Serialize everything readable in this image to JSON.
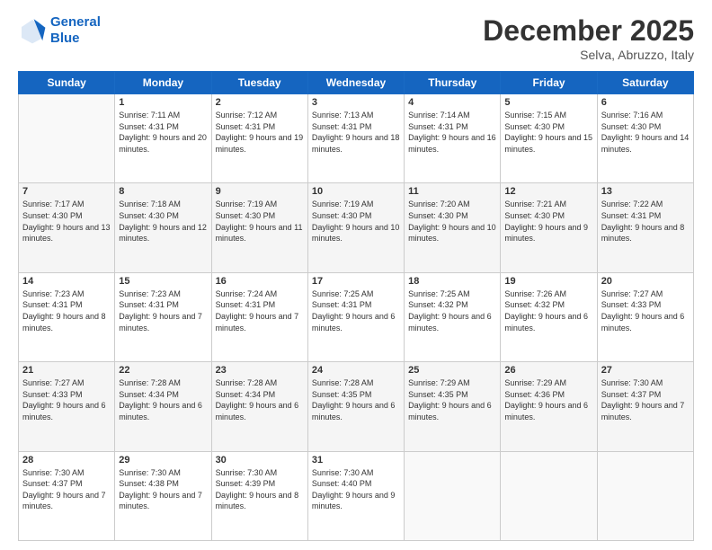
{
  "logo": {
    "line1": "General",
    "line2": "Blue"
  },
  "header": {
    "month": "December 2025",
    "location": "Selva, Abruzzo, Italy"
  },
  "weekdays": [
    "Sunday",
    "Monday",
    "Tuesday",
    "Wednesday",
    "Thursday",
    "Friday",
    "Saturday"
  ],
  "weeks": [
    [
      {
        "day": "",
        "sunrise": "",
        "sunset": "",
        "daylight": ""
      },
      {
        "day": "1",
        "sunrise": "Sunrise: 7:11 AM",
        "sunset": "Sunset: 4:31 PM",
        "daylight": "Daylight: 9 hours and 20 minutes."
      },
      {
        "day": "2",
        "sunrise": "Sunrise: 7:12 AM",
        "sunset": "Sunset: 4:31 PM",
        "daylight": "Daylight: 9 hours and 19 minutes."
      },
      {
        "day": "3",
        "sunrise": "Sunrise: 7:13 AM",
        "sunset": "Sunset: 4:31 PM",
        "daylight": "Daylight: 9 hours and 18 minutes."
      },
      {
        "day": "4",
        "sunrise": "Sunrise: 7:14 AM",
        "sunset": "Sunset: 4:31 PM",
        "daylight": "Daylight: 9 hours and 16 minutes."
      },
      {
        "day": "5",
        "sunrise": "Sunrise: 7:15 AM",
        "sunset": "Sunset: 4:30 PM",
        "daylight": "Daylight: 9 hours and 15 minutes."
      },
      {
        "day": "6",
        "sunrise": "Sunrise: 7:16 AM",
        "sunset": "Sunset: 4:30 PM",
        "daylight": "Daylight: 9 hours and 14 minutes."
      }
    ],
    [
      {
        "day": "7",
        "sunrise": "Sunrise: 7:17 AM",
        "sunset": "Sunset: 4:30 PM",
        "daylight": "Daylight: 9 hours and 13 minutes."
      },
      {
        "day": "8",
        "sunrise": "Sunrise: 7:18 AM",
        "sunset": "Sunset: 4:30 PM",
        "daylight": "Daylight: 9 hours and 12 minutes."
      },
      {
        "day": "9",
        "sunrise": "Sunrise: 7:19 AM",
        "sunset": "Sunset: 4:30 PM",
        "daylight": "Daylight: 9 hours and 11 minutes."
      },
      {
        "day": "10",
        "sunrise": "Sunrise: 7:19 AM",
        "sunset": "Sunset: 4:30 PM",
        "daylight": "Daylight: 9 hours and 10 minutes."
      },
      {
        "day": "11",
        "sunrise": "Sunrise: 7:20 AM",
        "sunset": "Sunset: 4:30 PM",
        "daylight": "Daylight: 9 hours and 10 minutes."
      },
      {
        "day": "12",
        "sunrise": "Sunrise: 7:21 AM",
        "sunset": "Sunset: 4:30 PM",
        "daylight": "Daylight: 9 hours and 9 minutes."
      },
      {
        "day": "13",
        "sunrise": "Sunrise: 7:22 AM",
        "sunset": "Sunset: 4:31 PM",
        "daylight": "Daylight: 9 hours and 8 minutes."
      }
    ],
    [
      {
        "day": "14",
        "sunrise": "Sunrise: 7:23 AM",
        "sunset": "Sunset: 4:31 PM",
        "daylight": "Daylight: 9 hours and 8 minutes."
      },
      {
        "day": "15",
        "sunrise": "Sunrise: 7:23 AM",
        "sunset": "Sunset: 4:31 PM",
        "daylight": "Daylight: 9 hours and 7 minutes."
      },
      {
        "day": "16",
        "sunrise": "Sunrise: 7:24 AM",
        "sunset": "Sunset: 4:31 PM",
        "daylight": "Daylight: 9 hours and 7 minutes."
      },
      {
        "day": "17",
        "sunrise": "Sunrise: 7:25 AM",
        "sunset": "Sunset: 4:31 PM",
        "daylight": "Daylight: 9 hours and 6 minutes."
      },
      {
        "day": "18",
        "sunrise": "Sunrise: 7:25 AM",
        "sunset": "Sunset: 4:32 PM",
        "daylight": "Daylight: 9 hours and 6 minutes."
      },
      {
        "day": "19",
        "sunrise": "Sunrise: 7:26 AM",
        "sunset": "Sunset: 4:32 PM",
        "daylight": "Daylight: 9 hours and 6 minutes."
      },
      {
        "day": "20",
        "sunrise": "Sunrise: 7:27 AM",
        "sunset": "Sunset: 4:33 PM",
        "daylight": "Daylight: 9 hours and 6 minutes."
      }
    ],
    [
      {
        "day": "21",
        "sunrise": "Sunrise: 7:27 AM",
        "sunset": "Sunset: 4:33 PM",
        "daylight": "Daylight: 9 hours and 6 minutes."
      },
      {
        "day": "22",
        "sunrise": "Sunrise: 7:28 AM",
        "sunset": "Sunset: 4:34 PM",
        "daylight": "Daylight: 9 hours and 6 minutes."
      },
      {
        "day": "23",
        "sunrise": "Sunrise: 7:28 AM",
        "sunset": "Sunset: 4:34 PM",
        "daylight": "Daylight: 9 hours and 6 minutes."
      },
      {
        "day": "24",
        "sunrise": "Sunrise: 7:28 AM",
        "sunset": "Sunset: 4:35 PM",
        "daylight": "Daylight: 9 hours and 6 minutes."
      },
      {
        "day": "25",
        "sunrise": "Sunrise: 7:29 AM",
        "sunset": "Sunset: 4:35 PM",
        "daylight": "Daylight: 9 hours and 6 minutes."
      },
      {
        "day": "26",
        "sunrise": "Sunrise: 7:29 AM",
        "sunset": "Sunset: 4:36 PM",
        "daylight": "Daylight: 9 hours and 6 minutes."
      },
      {
        "day": "27",
        "sunrise": "Sunrise: 7:30 AM",
        "sunset": "Sunset: 4:37 PM",
        "daylight": "Daylight: 9 hours and 7 minutes."
      }
    ],
    [
      {
        "day": "28",
        "sunrise": "Sunrise: 7:30 AM",
        "sunset": "Sunset: 4:37 PM",
        "daylight": "Daylight: 9 hours and 7 minutes."
      },
      {
        "day": "29",
        "sunrise": "Sunrise: 7:30 AM",
        "sunset": "Sunset: 4:38 PM",
        "daylight": "Daylight: 9 hours and 7 minutes."
      },
      {
        "day": "30",
        "sunrise": "Sunrise: 7:30 AM",
        "sunset": "Sunset: 4:39 PM",
        "daylight": "Daylight: 9 hours and 8 minutes."
      },
      {
        "day": "31",
        "sunrise": "Sunrise: 7:30 AM",
        "sunset": "Sunset: 4:40 PM",
        "daylight": "Daylight: 9 hours and 9 minutes."
      },
      {
        "day": "",
        "sunrise": "",
        "sunset": "",
        "daylight": ""
      },
      {
        "day": "",
        "sunrise": "",
        "sunset": "",
        "daylight": ""
      },
      {
        "day": "",
        "sunrise": "",
        "sunset": "",
        "daylight": ""
      }
    ]
  ]
}
